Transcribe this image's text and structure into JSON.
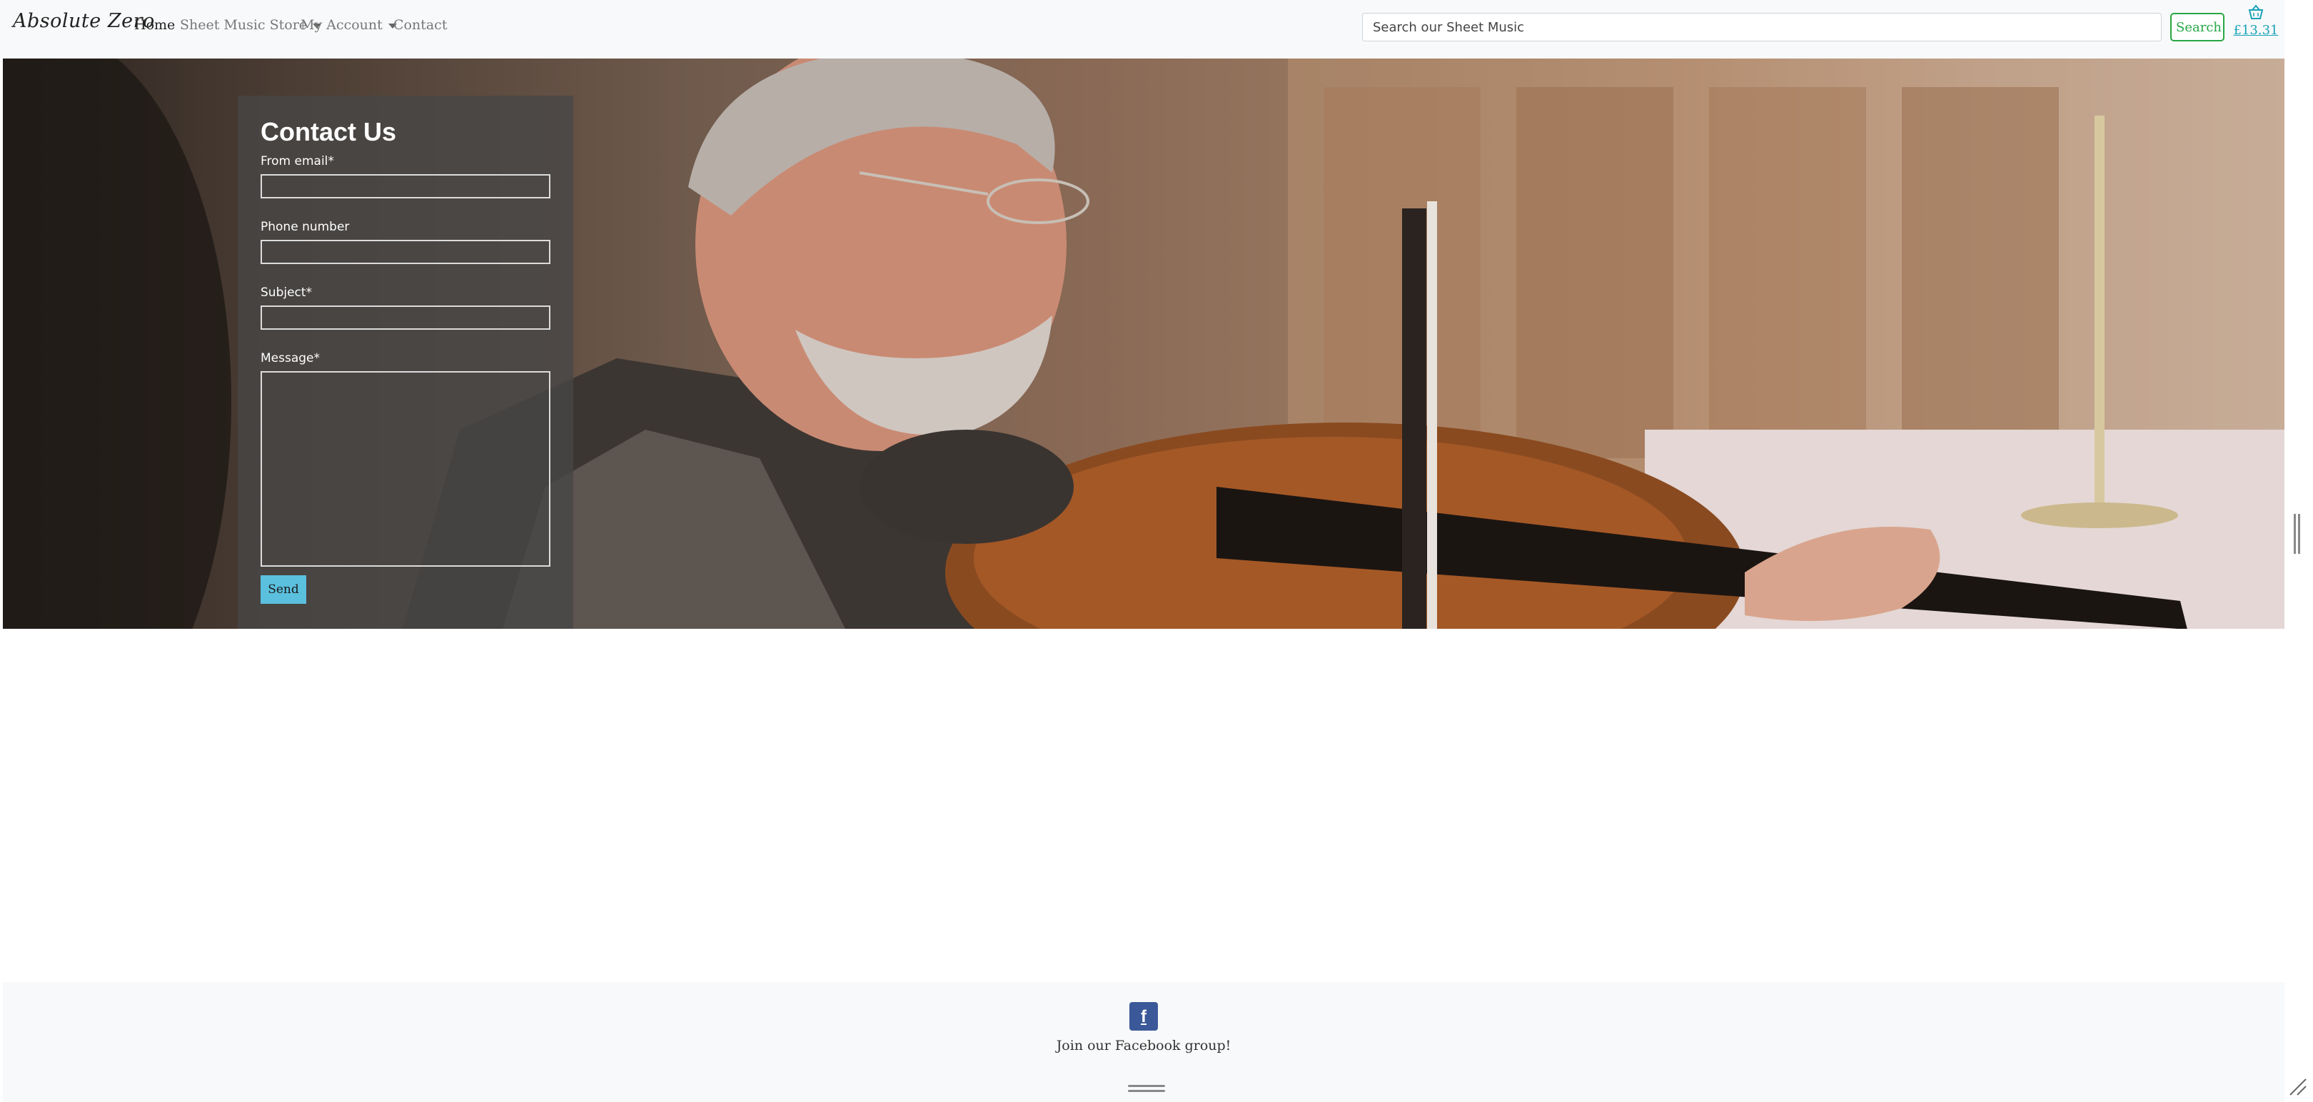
{
  "navbar": {
    "brand": "Absolute Zero",
    "links": {
      "home": "Home",
      "store": "Sheet Music Store",
      "account": "My Account",
      "contact": "Contact"
    },
    "search": {
      "placeholder": "Search our Sheet Music",
      "button_label": "Search"
    },
    "cart": {
      "icon": "basket-icon",
      "total": "£13.31"
    }
  },
  "contact_form": {
    "title": "Contact Us",
    "fields": {
      "email_label": "From email*",
      "phone_label": "Phone number",
      "subject_label": "Subject*",
      "message_label": "Message*"
    },
    "send_label": "Send"
  },
  "footer": {
    "facebook_icon": "f",
    "facebook_text": "Join our Facebook group!"
  },
  "colors": {
    "accent_green": "#28a745",
    "accent_info": "#17a2b8",
    "send_button": "#5bc0de",
    "facebook_blue": "#3b5998",
    "navbar_bg": "#f8f9fa"
  }
}
